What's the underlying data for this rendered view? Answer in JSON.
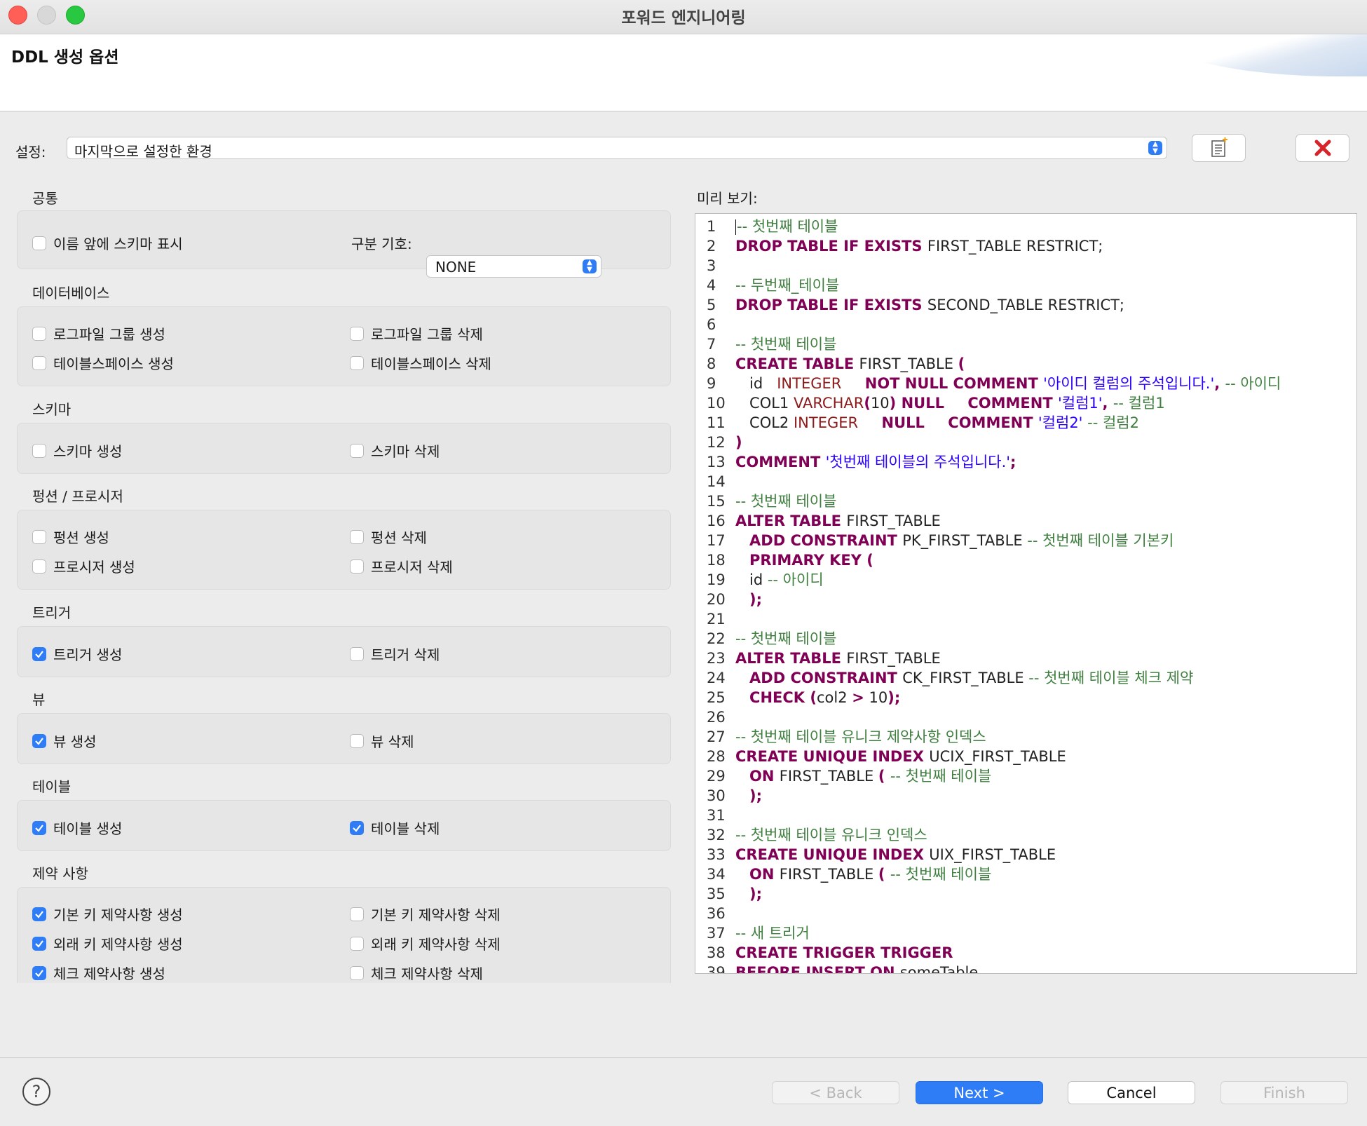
{
  "window": {
    "title": "포워드 엔지니어링"
  },
  "header": {
    "title": "DDL 생성 옵션"
  },
  "settings": {
    "label": "설정:",
    "value": "마지막으로 설정한 환경"
  },
  "groups": [
    {
      "title": "공통",
      "options": [
        {
          "label": "이름 앞에 스키마 표시",
          "checked": false
        }
      ]
    },
    {
      "title": "데이터베이스",
      "options": [
        {
          "label": "로그파일 그룹 생성",
          "checked": false
        },
        {
          "label": "로그파일 그룹 삭제",
          "checked": false
        },
        {
          "label": "테이블스페이스 생성",
          "checked": false
        },
        {
          "label": "테이블스페이스 삭제",
          "checked": false
        }
      ]
    },
    {
      "title": "스키마",
      "options": [
        {
          "label": "스키마 생성",
          "checked": false
        },
        {
          "label": "스키마 삭제",
          "checked": false
        }
      ]
    },
    {
      "title": "펑션 / 프로시저",
      "options": [
        {
          "label": "펑션 생성",
          "checked": false
        },
        {
          "label": "펑션 삭제",
          "checked": false
        },
        {
          "label": "프로시저 생성",
          "checked": false
        },
        {
          "label": "프로시저 삭제",
          "checked": false
        }
      ]
    },
    {
      "title": "트리거",
      "options": [
        {
          "label": "트리거 생성",
          "checked": true
        },
        {
          "label": "트리거 삭제",
          "checked": false
        }
      ]
    },
    {
      "title": "뷰",
      "options": [
        {
          "label": "뷰 생성",
          "checked": true
        },
        {
          "label": "뷰 삭제",
          "checked": false
        }
      ]
    },
    {
      "title": "테이블",
      "options": [
        {
          "label": "테이블 생성",
          "checked": true
        },
        {
          "label": "테이블 삭제",
          "checked": true
        }
      ]
    },
    {
      "title": "제약 사항",
      "options": [
        {
          "label": "기본 키 제약사항 생성",
          "checked": true
        },
        {
          "label": "기본 키 제약사항 삭제",
          "checked": false
        },
        {
          "label": "외래 키 제약사항 생성",
          "checked": true
        },
        {
          "label": "외래 키 제약사항 삭제",
          "checked": false
        },
        {
          "label": "체크 제약사항 생성",
          "checked": true
        },
        {
          "label": "체크 제약사항 삭제",
          "checked": false
        }
      ]
    }
  ],
  "separator": {
    "label": "구분 기호:",
    "value": "NONE"
  },
  "preview": {
    "label": "미리 보기:",
    "lines": [
      [
        [
          "cm",
          "-- 첫번째 테이블"
        ]
      ],
      [
        [
          "kw",
          "DROP TABLE IF EXISTS "
        ],
        [
          "id",
          "FIRST_TABLE RESTRICT;"
        ]
      ],
      [],
      [
        [
          "cm",
          "-- 두번째_테이블"
        ]
      ],
      [
        [
          "kw",
          "DROP TABLE IF EXISTS "
        ],
        [
          "id",
          "SECOND_TABLE RESTRICT;"
        ]
      ],
      [],
      [
        [
          "cm",
          "-- 첫번째 테이블"
        ]
      ],
      [
        [
          "kw",
          "CREATE TABLE "
        ],
        [
          "id",
          "FIRST_TABLE "
        ],
        [
          "kw",
          "("
        ]
      ],
      [
        [
          "id",
          "   id   "
        ],
        [
          "ty",
          "INTEGER"
        ],
        [
          "id",
          "     "
        ],
        [
          "kw",
          "NOT NULL COMMENT "
        ],
        [
          "st",
          "'아이디 컬럼의 주석입니다.'"
        ],
        [
          "kw",
          ", "
        ],
        [
          "cm",
          "-- 아이디"
        ]
      ],
      [
        [
          "id",
          "   COL1 "
        ],
        [
          "ty",
          "VARCHAR"
        ],
        [
          "kw",
          "("
        ],
        [
          "id",
          "10"
        ],
        [
          "kw",
          ") NULL"
        ],
        [
          "id",
          "     "
        ],
        [
          "kw",
          "COMMENT "
        ],
        [
          "st",
          "'컬럼1'"
        ],
        [
          "kw",
          ", "
        ],
        [
          "cm",
          "-- 컬럼1"
        ]
      ],
      [
        [
          "id",
          "   COL2 "
        ],
        [
          "ty",
          "INTEGER"
        ],
        [
          "id",
          "     "
        ],
        [
          "kw",
          "NULL"
        ],
        [
          "id",
          "     "
        ],
        [
          "kw",
          "COMMENT "
        ],
        [
          "st",
          "'컬럼2'"
        ],
        [
          "id",
          " "
        ],
        [
          "cm",
          "-- 컬럼2"
        ]
      ],
      [
        [
          "kw",
          ")"
        ]
      ],
      [
        [
          "kw",
          "COMMENT "
        ],
        [
          "st",
          "'첫번째 테이블의 주석입니다.'"
        ],
        [
          "kw",
          ";"
        ]
      ],
      [],
      [
        [
          "cm",
          "-- 첫번째 테이블"
        ]
      ],
      [
        [
          "kw",
          "ALTER TABLE "
        ],
        [
          "id",
          "FIRST_TABLE"
        ]
      ],
      [
        [
          "id",
          "   "
        ],
        [
          "kw",
          "ADD CONSTRAINT "
        ],
        [
          "id",
          "PK_FIRST_TABLE "
        ],
        [
          "cm",
          "-- 첫번째 테이블 기본키"
        ]
      ],
      [
        [
          "id",
          "   "
        ],
        [
          "kw",
          "PRIMARY KEY ("
        ]
      ],
      [
        [
          "id",
          "   id "
        ],
        [
          "cm",
          "-- 아이디"
        ]
      ],
      [
        [
          "id",
          "   "
        ],
        [
          "kw",
          ");"
        ]
      ],
      [],
      [
        [
          "cm",
          "-- 첫번째 테이블"
        ]
      ],
      [
        [
          "kw",
          "ALTER TABLE "
        ],
        [
          "id",
          "FIRST_TABLE"
        ]
      ],
      [
        [
          "id",
          "   "
        ],
        [
          "kw",
          "ADD CONSTRAINT "
        ],
        [
          "id",
          "CK_FIRST_TABLE "
        ],
        [
          "cm",
          "-- 첫번째 테이블 체크 제약"
        ]
      ],
      [
        [
          "id",
          "   "
        ],
        [
          "kw",
          "CHECK "
        ],
        [
          "kw",
          "("
        ],
        [
          "id",
          "col2 "
        ],
        [
          "kw",
          ">"
        ],
        [
          "id",
          " 10"
        ],
        [
          "kw",
          ");"
        ]
      ],
      [],
      [
        [
          "cm",
          "-- 첫번째 테이블 유니크 제약사항 인덱스"
        ]
      ],
      [
        [
          "kw",
          "CREATE UNIQUE INDEX "
        ],
        [
          "id",
          "UCIX_FIRST_TABLE"
        ]
      ],
      [
        [
          "id",
          "   "
        ],
        [
          "kw",
          "ON "
        ],
        [
          "id",
          "FIRST_TABLE "
        ],
        [
          "kw",
          "( "
        ],
        [
          "cm",
          "-- 첫번째 테이블"
        ]
      ],
      [
        [
          "id",
          "   "
        ],
        [
          "kw",
          ");"
        ]
      ],
      [],
      [
        [
          "cm",
          "-- 첫번째 테이블 유니크 인덱스"
        ]
      ],
      [
        [
          "kw",
          "CREATE UNIQUE INDEX "
        ],
        [
          "id",
          "UIX_FIRST_TABLE"
        ]
      ],
      [
        [
          "id",
          "   "
        ],
        [
          "kw",
          "ON "
        ],
        [
          "id",
          "FIRST_TABLE "
        ],
        [
          "kw",
          "( "
        ],
        [
          "cm",
          "-- 첫번째 테이블"
        ]
      ],
      [
        [
          "id",
          "   "
        ],
        [
          "kw",
          ");"
        ]
      ],
      [],
      [
        [
          "cm",
          "-- 새 트리거"
        ]
      ],
      [
        [
          "kw",
          "CREATE TRIGGER TRIGGER"
        ]
      ],
      [
        [
          "kw",
          "BEFORE INSERT ON "
        ],
        [
          "id",
          "someTable"
        ]
      ]
    ]
  },
  "footer": {
    "back": "< Back",
    "next": "Next >",
    "cancel": "Cancel",
    "finish": "Finish",
    "help": "?"
  },
  "colors": {
    "accent": "#2f7df6",
    "keyword": "#7f0055",
    "comment": "#3f7f3f",
    "string": "#2a00ff"
  },
  "icons": {
    "save": "save-settings-icon",
    "delete": "delete-settings-icon"
  }
}
